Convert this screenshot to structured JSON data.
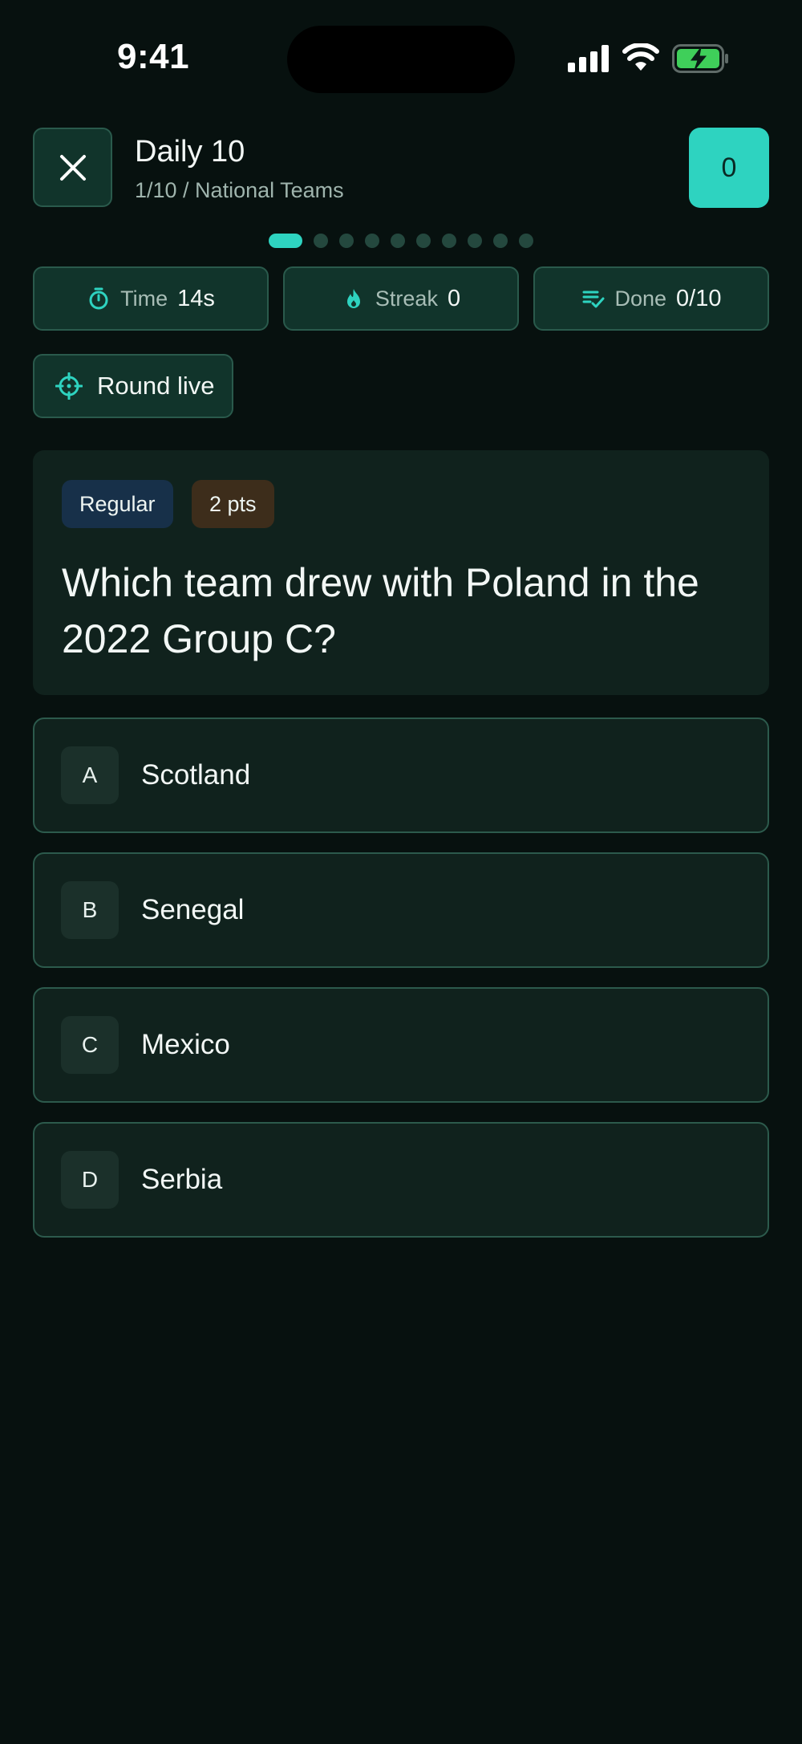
{
  "status_bar": {
    "time": "9:41"
  },
  "header": {
    "title": "Daily 10",
    "subtitle": "1/10 / National Teams",
    "score": "0"
  },
  "progress": {
    "current": 1,
    "total": 10
  },
  "stats": [
    {
      "label": "Time",
      "value": "14s",
      "icon": "stopwatch-icon"
    },
    {
      "label": "Streak",
      "value": "0",
      "icon": "flame-icon"
    },
    {
      "label": "Done",
      "value": "0/10",
      "icon": "list-check-icon"
    }
  ],
  "round_status": {
    "label": "Round live",
    "icon": "crosshair-icon"
  },
  "question": {
    "difficulty": "Regular",
    "points": "2 pts",
    "text": "Which team drew with Poland in the 2022 Group C?"
  },
  "answers": [
    {
      "letter": "A",
      "text": "Scotland"
    },
    {
      "letter": "B",
      "text": "Senegal"
    },
    {
      "letter": "C",
      "text": "Mexico"
    },
    {
      "letter": "D",
      "text": "Serbia"
    }
  ],
  "colors": {
    "background": "#07110f",
    "accent": "#2ed3c0",
    "card": "#10221d",
    "pill": "#11342b",
    "border": "#2a5a4c",
    "battery": "#3fcf5a"
  }
}
